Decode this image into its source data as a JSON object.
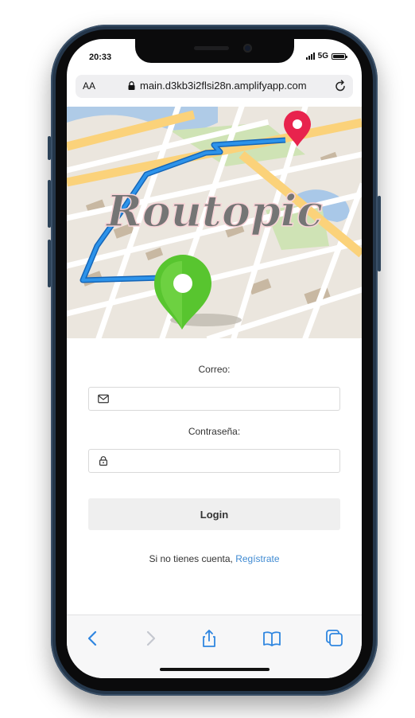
{
  "status": {
    "time": "20:33",
    "network": "5G"
  },
  "browser": {
    "text_size_label": "AA",
    "url": "main.d3kb3i2flsi28n.amplifyapp.com"
  },
  "banner": {
    "logo_text": "Routopic"
  },
  "form": {
    "email_label": "Correo:",
    "email_value": "",
    "password_label": "Contraseña:",
    "password_value": "",
    "login_label": "Login",
    "signup_prompt": "Si no tienes cuenta, ",
    "signup_link": "Regístrate"
  },
  "colors": {
    "accent": "#3f8ad2",
    "route": "#1e7fd6",
    "start_pin": "#5ccd32",
    "end_pin": "#e8234d",
    "phone_frame": "#24364a"
  },
  "toolbar_icons": [
    "back-icon",
    "forward-icon",
    "share-icon",
    "bookmarks-icon",
    "tabs-icon"
  ]
}
